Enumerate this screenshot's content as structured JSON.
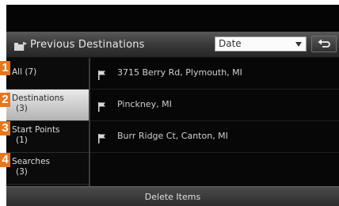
{
  "header": {
    "title": "Previous Destinations",
    "title_icon": "folder-flag-icon",
    "sort_select": {
      "value": "Date"
    },
    "back_icon": "back-arrow-icon"
  },
  "sidebar": {
    "items": [
      {
        "line1": "All (7)",
        "line2": "",
        "selected": false
      },
      {
        "line1": "Destinations",
        "line2": "(3)",
        "selected": true
      },
      {
        "line1": "Start Points",
        "line2": "(1)",
        "selected": false
      },
      {
        "line1": "Searches",
        "line2": "(3)",
        "selected": false
      }
    ]
  },
  "list": {
    "items": [
      {
        "icon": "flag-icon",
        "text": "3715 Berry Rd, Plymouth, MI"
      },
      {
        "icon": "flag-icon",
        "text": "Pinckney, MI"
      },
      {
        "icon": "flag-icon",
        "text": "Burr Ridge Ct, Canton, MI"
      }
    ]
  },
  "footer": {
    "delete_label": "Delete Items"
  },
  "callouts": [
    "1",
    "2",
    "3",
    "4"
  ],
  "colors": {
    "callout": "#e8761b",
    "background": "#050505",
    "selected_item": "#d8d8d8"
  }
}
